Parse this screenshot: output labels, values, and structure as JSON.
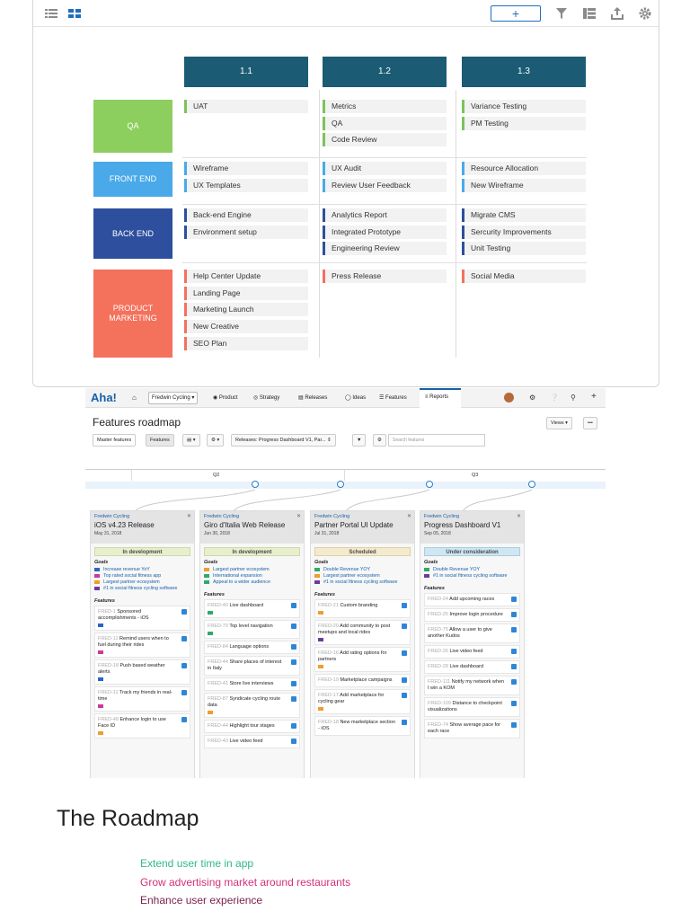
{
  "panel1": {
    "columns": [
      "1.1",
      "1.2",
      "1.3"
    ],
    "rows": [
      {
        "label": "QA",
        "color": "#8dcf5f",
        "accent": "#7dc35b",
        "cells": [
          [
            "UAT"
          ],
          [
            "Metrics",
            "QA",
            "Code Review"
          ],
          [
            "Variance Testing",
            "PM Testing"
          ]
        ]
      },
      {
        "label": "FRONT END",
        "color": "#4aa9e9",
        "accent": "#4aa9e9",
        "cells": [
          [
            "Wireframe",
            "UX Templates"
          ],
          [
            "UX Audit",
            "Review User Feedback"
          ],
          [
            "Resource Allocation",
            "New Wireframe"
          ]
        ]
      },
      {
        "label": "BACK END",
        "color": "#2e4f9e",
        "accent": "#2e4f9e",
        "cells": [
          [
            "Back-end Engine",
            "Environment setup"
          ],
          [
            "Analytics Report",
            "Integrated Prototype",
            "Engineering Review"
          ],
          [
            "Migrate CMS",
            "Sercurity Improvements",
            "Unit Testing"
          ]
        ]
      },
      {
        "label": "PRODUCT MARKETING",
        "color": "#f4715c",
        "accent": "#f4715c",
        "cells": [
          [
            "Help Center Update",
            "Landing Page",
            "Marketing Launch",
            "New Creative",
            "SEO Plan"
          ],
          [
            "Press Release"
          ],
          [
            "Social Media"
          ]
        ]
      }
    ]
  },
  "aha": {
    "logo": "Aha!",
    "workspace": "Fredwin Cycling",
    "nav": [
      "Product",
      "Strategy",
      "Releases",
      "Ideas",
      "Features",
      "Reports"
    ],
    "page_title": "Features roadmap",
    "views_label": "Views",
    "tabs": [
      "Master features",
      "Features"
    ],
    "releases_filter": "Releases: Progress Dashboard V1, Par...",
    "search_placeholder": "Search features",
    "quarters": [
      "Q2",
      "Q3"
    ],
    "releases": [
      {
        "brand": "Fredwin Cycling",
        "title": "iOS v4.23 Release",
        "date": "May 31, 2018",
        "status": "In development",
        "status_class": "st-dev",
        "goals_label": "Goals",
        "goals": [
          [
            "Increase revenue YoY",
            "#2c63c9"
          ],
          [
            "Top rated social fitness app",
            "#c93a9a"
          ],
          [
            "Largest partner ecosystem",
            "#f39c2b"
          ],
          [
            "#1 in social fitness cycling software",
            "#6a3d9a"
          ]
        ],
        "features_label": "Features",
        "features": [
          [
            "FRED-1",
            "Sponsored accomplishments - iOS",
            "#2c63c9"
          ],
          [
            "FRED-11",
            "Remind users when to fuel during their rides",
            "#c93a9a"
          ],
          [
            "FRED-18",
            "Push based weather alerts",
            "#2c63c9"
          ],
          [
            "FRED-11",
            "Track my friends in real-time",
            "#c93a9a"
          ],
          [
            "FRED-48",
            "Enhance login to use Face ID",
            "#f39c2b"
          ]
        ]
      },
      {
        "brand": "Fredwin Cycling",
        "title": "Giro d'Italia Web Release",
        "date": "Jun 30, 2018",
        "status": "In development",
        "status_class": "st-dev",
        "goals_label": "Goals",
        "goals": [
          [
            "Largest partner ecosystem",
            "#f39c2b"
          ],
          [
            "International expansion",
            "#2eaa6b"
          ],
          [
            "Appeal to a wider audience",
            "#2eaa6b"
          ]
        ],
        "features_label": "Features",
        "features": [
          [
            "FRED-40",
            "Live dashboard",
            "#2eaa6b"
          ],
          [
            "FRED-79",
            "Top level navigation",
            "#2eaa6b"
          ],
          [
            "FRED-84",
            "Language options",
            ""
          ],
          [
            "FRED-44",
            "Share places of interest in Italy",
            ""
          ],
          [
            "FRED-41",
            "Store live interviews",
            ""
          ],
          [
            "FRED-87",
            "Syndicate cycling route data",
            "#f39c2b"
          ],
          [
            "FRED-44",
            "Highlight tour stages",
            ""
          ],
          [
            "FRED-43",
            "Live video feed",
            ""
          ]
        ]
      },
      {
        "brand": "Fredwin Cycling",
        "title": "Partner Portal UI Update",
        "date": "Jul 31, 2018",
        "status": "Scheduled",
        "status_class": "st-sched",
        "goals_label": "Goals",
        "goals": [
          [
            "Double Revenue YOY",
            "#2eaa6b"
          ],
          [
            "Largest partner ecosystem",
            "#f39c2b"
          ],
          [
            "#1 in social fitness cycling software",
            "#6a3d9a"
          ]
        ],
        "features_label": "Features",
        "features": [
          [
            "FRED-21",
            "Custom branding",
            "#f39c2b"
          ],
          [
            "FRED-20",
            "Add community to post meetups and local rides",
            "#6a3d9a"
          ],
          [
            "FRED-16",
            "Add rating options for partners",
            "#f39c2b"
          ],
          [
            "FRED-19",
            "Marketplace campaigns",
            ""
          ],
          [
            "FRED-17",
            "Add marketplace for cycling gear",
            "#f39c2b"
          ],
          [
            "FRED-18",
            "New marketplace section - iOS",
            ""
          ]
        ]
      },
      {
        "brand": "Fredwin Cycling",
        "title": "Progress Dashboard V1",
        "date": "Sep 05, 2018",
        "status": "Under consideration",
        "status_class": "st-cons",
        "goals_label": "Goals",
        "goals": [
          [
            "Double Revenue YOY",
            "#2eaa6b"
          ],
          [
            "#1 in social fitness cycling software",
            "#6a3d9a"
          ]
        ],
        "features_label": "Features",
        "features": [
          [
            "FRED-24",
            "Add upcoming races",
            ""
          ],
          [
            "FRED-25",
            "Improve login procedure",
            ""
          ],
          [
            "FRED-75",
            "Allow a user to give another Kudos",
            ""
          ],
          [
            "FRED-26",
            "Live video feed",
            ""
          ],
          [
            "FRED-28",
            "Live dashboard",
            ""
          ],
          [
            "FRED-111",
            "Notify my network when I win a KOM",
            ""
          ],
          [
            "FRED-109",
            "Distance to checkpoint visualizations",
            ""
          ],
          [
            "FRED-74",
            "Show average pace for each race",
            ""
          ]
        ]
      }
    ]
  },
  "roadmap": {
    "title": "The Roadmap",
    "items": [
      {
        "text": "Extend user time in app",
        "color": "#2fb88e"
      },
      {
        "text": "Grow advertising market around restaurants",
        "color": "#d4307a"
      },
      {
        "text": "Enhance user experience",
        "color": "#7a1f4e"
      }
    ]
  }
}
